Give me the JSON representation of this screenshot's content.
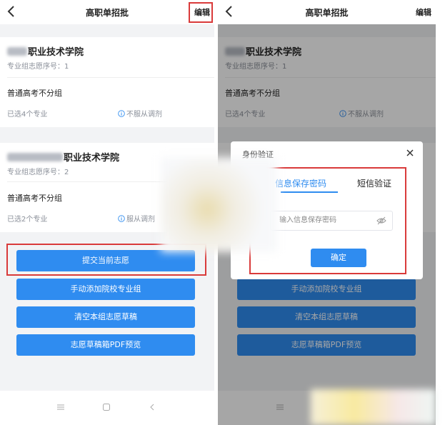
{
  "header": {
    "title": "高职单招批",
    "edit_label": "编辑"
  },
  "cards": [
    {
      "school_name": "职业技术学院",
      "order_label": "专业组志愿序号：1",
      "group": "普通高考不分组",
      "selected": "已选4个专业",
      "adjust": "不服从调剂"
    },
    {
      "school_name": "职业技术学院",
      "order_label": "专业组志愿序号：2",
      "group": "普通高考不分组",
      "selected": "已选2个专业",
      "adjust": "服从调剂"
    }
  ],
  "buttons": {
    "submit": "提交当前志愿",
    "add_group": "手动添加院校专业组",
    "clear_draft": "清空本组志愿草稿",
    "pdf_preview": "志愿草稿箱PDF预览"
  },
  "dialog": {
    "title": "身份验证",
    "tab_password": "信息保存密码",
    "tab_sms": "短信验证",
    "input_placeholder": "输入信息保存密码",
    "confirm": "确定"
  },
  "colors": {
    "primary": "#2f8cf0",
    "highlight_box": "#d93a3a",
    "background": "#f2f3f5"
  },
  "icons": [
    "chevron-left-icon",
    "info-circle-icon",
    "close-icon",
    "eye-off-icon",
    "menu-icon",
    "square-icon",
    "back-triangle-icon"
  ]
}
